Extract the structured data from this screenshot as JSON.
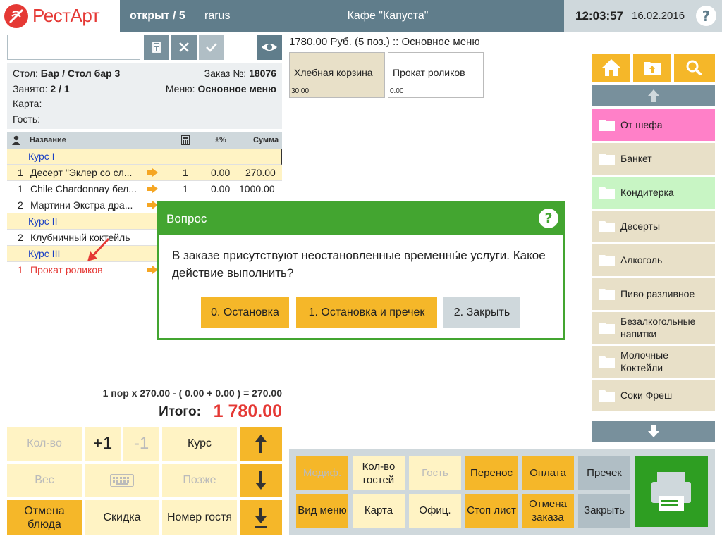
{
  "header": {
    "logo": "РестАрт",
    "status": "открыт / 5",
    "user": "rarus",
    "cafe": "Кафе \"Капуста\"",
    "time": "12:03:57",
    "date": "16.02.2016"
  },
  "left": {
    "search_value": "",
    "info": {
      "table_label": "Стол:",
      "table_value": "Бар / Стол бар 3",
      "order_label": "Заказ №:",
      "order_value": "18076",
      "occupied_label": "Занято:",
      "occupied_value": "2 / 1",
      "menu_label": "Меню:",
      "menu_value": "Основное меню",
      "card_label": "Карта:",
      "guest_label": "Гость:"
    },
    "table_headers": {
      "name": "Название",
      "discount": "±%",
      "sum": "Сумма"
    },
    "rows": [
      {
        "type": "course",
        "name": "Курс I"
      },
      {
        "type": "item",
        "guest": "1",
        "name": "Десерт \"Эклер со сл...",
        "qty": "1",
        "disc": "0.00",
        "sum": "270.00"
      },
      {
        "type": "item",
        "guest": "1",
        "name": "Chile Chardonnay бел...",
        "qty": "1",
        "disc": "0.00",
        "sum": "1000.00"
      },
      {
        "type": "item",
        "guest": "2",
        "name": "Мартини Экстра дра...",
        "qty": "",
        "disc": "",
        "sum": ""
      },
      {
        "type": "course",
        "name": "Курс II"
      },
      {
        "type": "item",
        "guest": "2",
        "name": "Клубничный коктейль",
        "qty": "",
        "disc": "",
        "sum": ""
      },
      {
        "type": "course",
        "name": "Курс III"
      },
      {
        "type": "item",
        "guest": "1",
        "name": "Прокат роликов",
        "qty": "",
        "disc": "",
        "sum": ""
      }
    ],
    "calc_line": "1 пор x 270.00 - ( 0.00 + 0.00 ) = 270.00",
    "total_label": "Итого:",
    "total_value": "1 780.00",
    "buttons": {
      "qty": "Кол-во",
      "plus_one": "+1",
      "minus_one": "-1",
      "course": "Курс",
      "weight": "Вес",
      "later": "Позже",
      "cancel_dish": "Отмена блюда",
      "discount": "Скидка",
      "guest_number": "Номер гостя"
    }
  },
  "menu": {
    "header": "1780.00 Руб. (5 поз.)  ::  Основное меню",
    "items": [
      {
        "name": "Хлебная корзина",
        "price": "30.00"
      },
      {
        "name": "Прокат роликов",
        "price": "0.00"
      }
    ]
  },
  "categories": [
    {
      "label": "От шефа",
      "color": "#ff80c8"
    },
    {
      "label": "Банкет",
      "color": "#e8e0c8"
    },
    {
      "label": "Кондитерка",
      "color": "#c8f5c4"
    },
    {
      "label": "Десерты",
      "color": "#e8e0c8"
    },
    {
      "label": "Алкоголь",
      "color": "#e8e0c8"
    },
    {
      "label": "Пиво разливное",
      "color": "#e8e0c8"
    },
    {
      "label": "Безалкогольные напитки",
      "color": "#e8e0c8"
    },
    {
      "label": "Молочные Коктейли",
      "color": "#e8e0c8"
    },
    {
      "label": "Соки Фреш",
      "color": "#e8e0c8"
    }
  ],
  "actions": {
    "modif": "Модиф.",
    "guest_count": "Кол-во гостей",
    "guest": "Гость",
    "transfer": "Перенос",
    "payment": "Оплата",
    "precheck": "Пречек",
    "view_menu": "Вид меню",
    "card": "Карта",
    "waiter": "Офиц.",
    "stop_list": "Стоп лист",
    "cancel_order": "Отмена заказа",
    "close": "Закрыть"
  },
  "dialog": {
    "title": "Вопрос",
    "message": "В заказе присутствуют неостановленные временны́е услуги. Какое действие выполнить?",
    "btn_stop": "0. Остановка",
    "btn_stop_precheck": "1. Остановка и пречек",
    "btn_close": "2. Закрыть"
  },
  "colors": {
    "accent_yellow": "#f5b729",
    "header_slate": "#607d8b",
    "dialog_green": "#43a530",
    "print_green": "#2e9e22",
    "total_red": "#e53935"
  }
}
